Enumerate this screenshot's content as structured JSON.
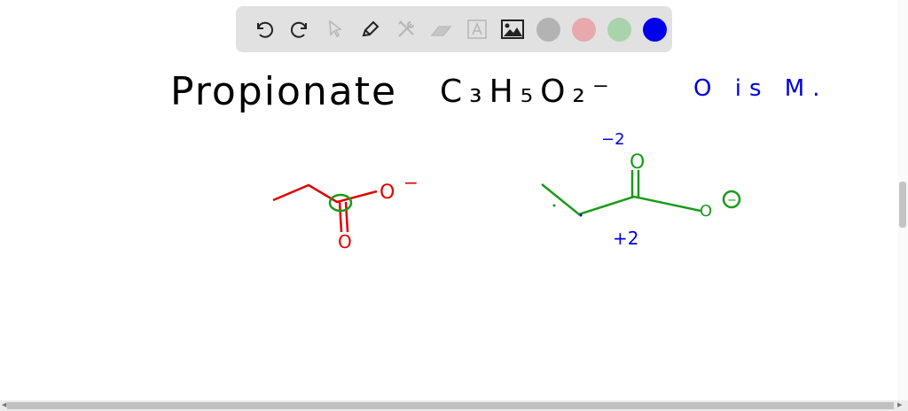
{
  "toolbar": {
    "tools": [
      "undo-icon",
      "redo-icon",
      "select-icon",
      "pen-icon",
      "tools-icon",
      "eraser-icon",
      "text-icon",
      "image-icon"
    ],
    "colors": [
      "#b3b3b3",
      "#e8a9ae",
      "#a9d4a9",
      "#0000ee"
    ],
    "selected_color": "#0000ee"
  },
  "board": {
    "title": "Propionate",
    "formula": "C₃H₅O₂⁻",
    "note": "O is M.",
    "left_structure": {
      "o_single": "O",
      "charge": "−",
      "o_double": "O"
    },
    "right_structure": {
      "o_top": "O",
      "top_charge": "−2",
      "o_single": "O",
      "charge_circle": "−",
      "carbon_ox": "+2"
    }
  }
}
